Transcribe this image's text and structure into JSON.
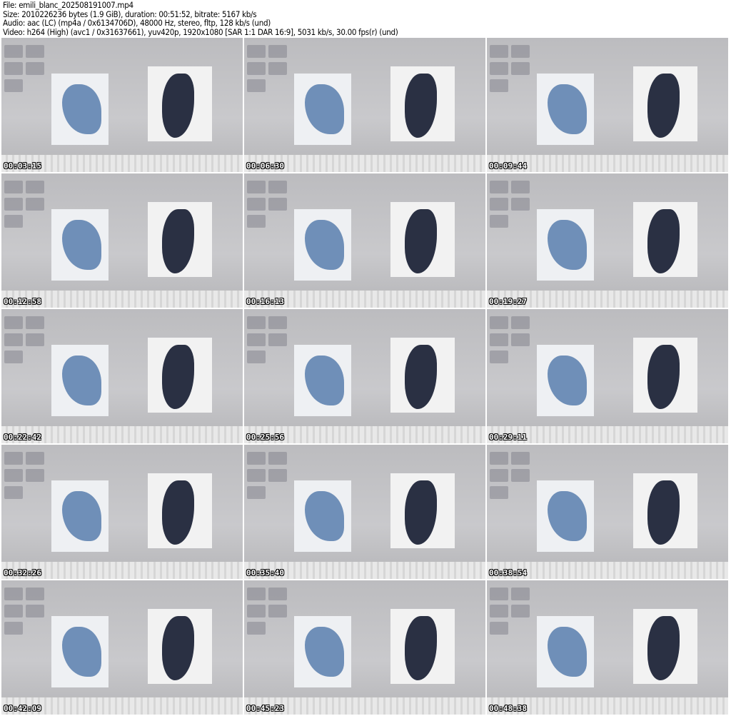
{
  "header": {
    "file": "File: emili_blanc_202508191007.mp4",
    "size": "Size: 2010226236 bytes (1.9 GiB), duration: 00:51:52, bitrate: 5167 kb/s",
    "audio": "Audio: aac (LC) (mp4a / 0x6134706D), 48000 Hz, stereo, fltp, 128 kb/s (und)",
    "video": "Video: h264 (High) (avc1 / 0x31637661), yuv420p, 1920x1080 [SAR 1:1 DAR 16:9], 5031 kb/s, 30.00 fps(r) (und)"
  },
  "thumbnails": [
    {
      "timestamp": "00:03:15"
    },
    {
      "timestamp": "00:06:30"
    },
    {
      "timestamp": "00:09:44"
    },
    {
      "timestamp": "00:12:58"
    },
    {
      "timestamp": "00:16:13"
    },
    {
      "timestamp": "00:19:27"
    },
    {
      "timestamp": "00:22:42"
    },
    {
      "timestamp": "00:25:56"
    },
    {
      "timestamp": "00:29:11"
    },
    {
      "timestamp": "00:32:26"
    },
    {
      "timestamp": "00:35:40"
    },
    {
      "timestamp": "00:38:54"
    },
    {
      "timestamp": "00:42:09"
    },
    {
      "timestamp": "00:45:23"
    },
    {
      "timestamp": "00:48:38"
    }
  ]
}
